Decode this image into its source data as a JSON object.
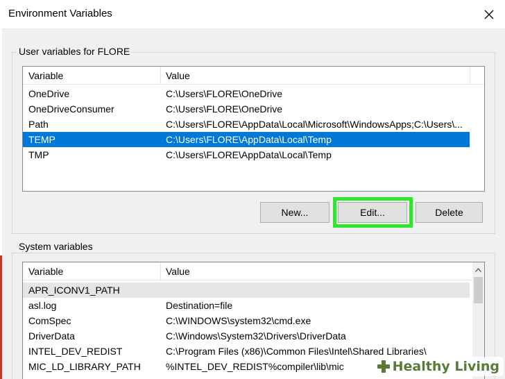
{
  "window": {
    "title": "Environment Variables",
    "close_glyph": "✕"
  },
  "user_vars": {
    "group_label": "User variables for FLORE",
    "columns": [
      "Variable",
      "Value"
    ],
    "rows": [
      {
        "variable": "OneDrive",
        "value": "C:\\Users\\FLORE\\OneDrive"
      },
      {
        "variable": "OneDriveConsumer",
        "value": "C:\\Users\\FLORE\\OneDrive"
      },
      {
        "variable": "Path",
        "value": "C:\\Users\\FLORE\\AppData\\Local\\Microsoft\\WindowsApps;C:\\Users\\..."
      },
      {
        "variable": "TEMP",
        "value": "C:\\Users\\FLORE\\AppData\\Local\\Temp"
      },
      {
        "variable": "TMP",
        "value": "C:\\Users\\FLORE\\AppData\\Local\\Temp"
      }
    ],
    "selected_row": "TEMP",
    "buttons": {
      "new": "New...",
      "edit": "Edit...",
      "delete": "Delete"
    }
  },
  "system_vars": {
    "group_label": "System variables",
    "columns": [
      "Variable",
      "Value"
    ],
    "rows": [
      {
        "variable": "APR_ICONV1_PATH",
        "value": ""
      },
      {
        "variable": "asl.log",
        "value": "Destination=file"
      },
      {
        "variable": "ComSpec",
        "value": "C:\\WINDOWS\\system32\\cmd.exe"
      },
      {
        "variable": "DriverData",
        "value": "C:\\Windows\\System32\\Drivers\\DriverData"
      },
      {
        "variable": "INTEL_DEV_REDIST",
        "value": "C:\\Program Files (x86)\\Common Files\\Intel\\Shared Libraries\\"
      },
      {
        "variable": "MIC_LD_LIBRARY_PATH",
        "value": "%INTEL_DEV_REDIST%compiler\\lib\\mic"
      }
    ]
  },
  "watermark": {
    "text": "Healthy Living"
  },
  "colors": {
    "selection": "#0078d7",
    "highlight_box": "#2ee62a",
    "watermark_green": "#5a7a3a"
  }
}
